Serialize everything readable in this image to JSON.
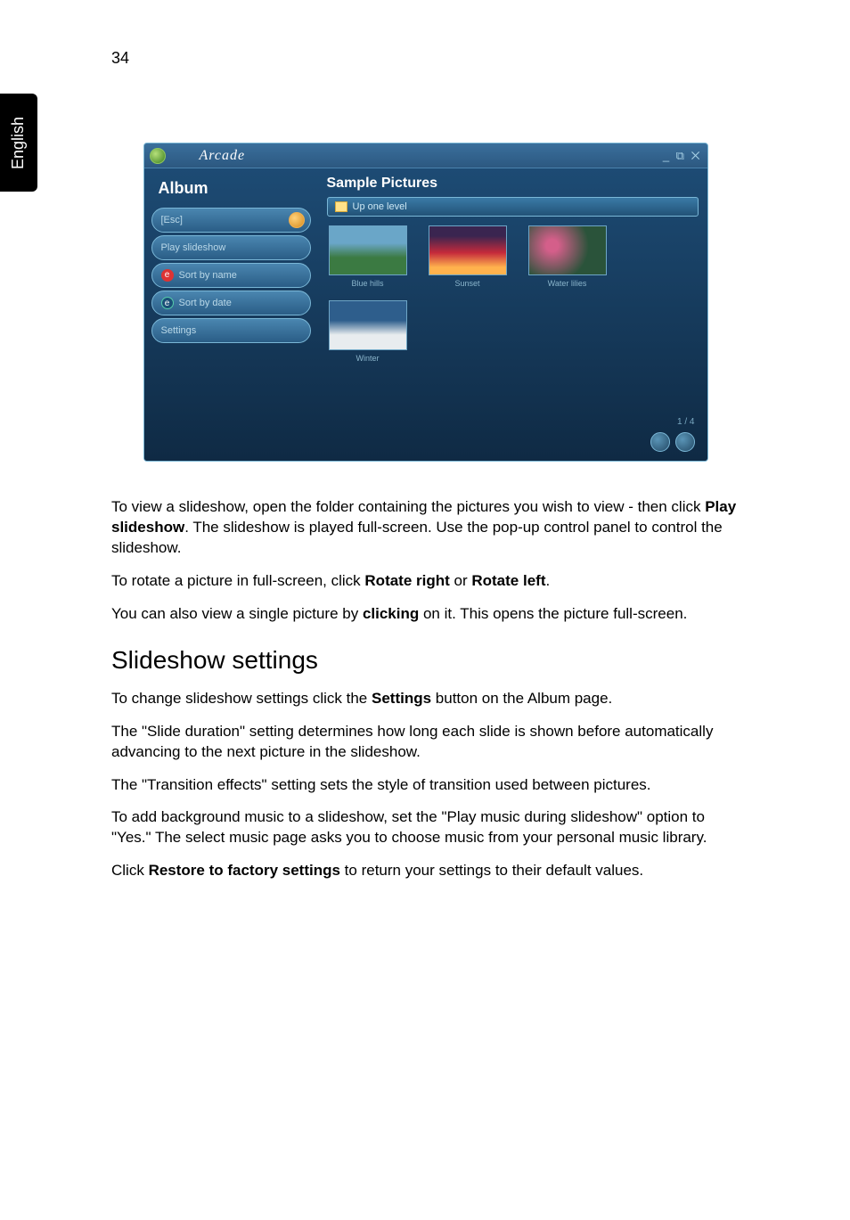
{
  "page_number": "34",
  "language_tab": "English",
  "screenshot": {
    "titlebar": {
      "title": "Arcade",
      "window_buttons": "_ ⧉ ✕"
    },
    "left": {
      "heading": "Album",
      "esc": "[Esc]",
      "items": [
        {
          "label": "Play slideshow"
        },
        {
          "label": "Sort by name",
          "badge": "e",
          "badge_class": "badge-red"
        },
        {
          "label": "Sort by date",
          "badge": "e",
          "badge_class": "badge-blue"
        },
        {
          "label": "Settings"
        }
      ]
    },
    "right": {
      "title": "Sample Pictures",
      "up_one_level": "Up one level",
      "thumbs": [
        {
          "caption": "Blue hills",
          "cls": "g-bluehills"
        },
        {
          "caption": "Sunset",
          "cls": "g-sunset"
        },
        {
          "caption": "Water lilies",
          "cls": "g-lilies"
        },
        {
          "caption": "Winter",
          "cls": "g-winter"
        }
      ],
      "page_indicator": "1 / 4"
    }
  },
  "body": {
    "p1a": "To view a slideshow, open the folder containing the pictures you wish to view - then click  ",
    "p1b": "Play slideshow",
    "p1c": ". The slideshow is played full-screen. Use the pop-up control panel to control the slideshow.",
    "p2a": "To rotate a picture in full-screen, click  ",
    "p2b": "Rotate right",
    "p2c": " or ",
    "p2d": "Rotate left",
    "p2e": ".",
    "p3a": "You can also view a single picture by ",
    "p3b": "clicking",
    "p3c": " on it. This opens the picture full-screen.",
    "h2": "Slideshow settings",
    "p4a": "To change slideshow settings click the ",
    "p4b": "Settings",
    "p4c": " button on the Album page.",
    "p5": "The \"Slide duration\" setting determines how long each slide is shown before automatically advancing to the next picture in the slideshow.",
    "p6": "The \"Transition effects\" setting sets the style of transition used between pictures.",
    "p7": "To add background music to a slideshow, set the \"Play music during slideshow\" option to \"Yes.\" The select music page asks you to choose music from your personal music library.",
    "p8a": "Click ",
    "p8b": "Restore to factory settings",
    "p8c": " to return your settings to their default values."
  }
}
